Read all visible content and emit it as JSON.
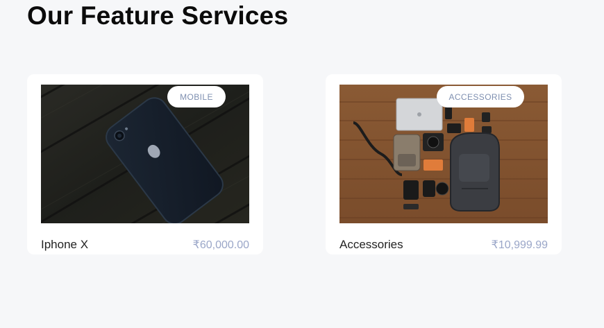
{
  "section": {
    "title": "Our Feature Services"
  },
  "cards": [
    {
      "badge": "MOBILE",
      "name": "Iphone X",
      "price": "₹60,000.00",
      "image_icon": "iphone-photo"
    },
    {
      "badge": "ACCESSORIES",
      "name": "Accessories",
      "price": "₹10,999.99",
      "image_icon": "accessories-flatlay-photo"
    }
  ],
  "colors": {
    "page_background": "#f6f7f9",
    "card_background": "#ffffff",
    "title": "#0b0b0b",
    "price": "#9aa6c8",
    "badge_text": "#7e8fb0"
  }
}
